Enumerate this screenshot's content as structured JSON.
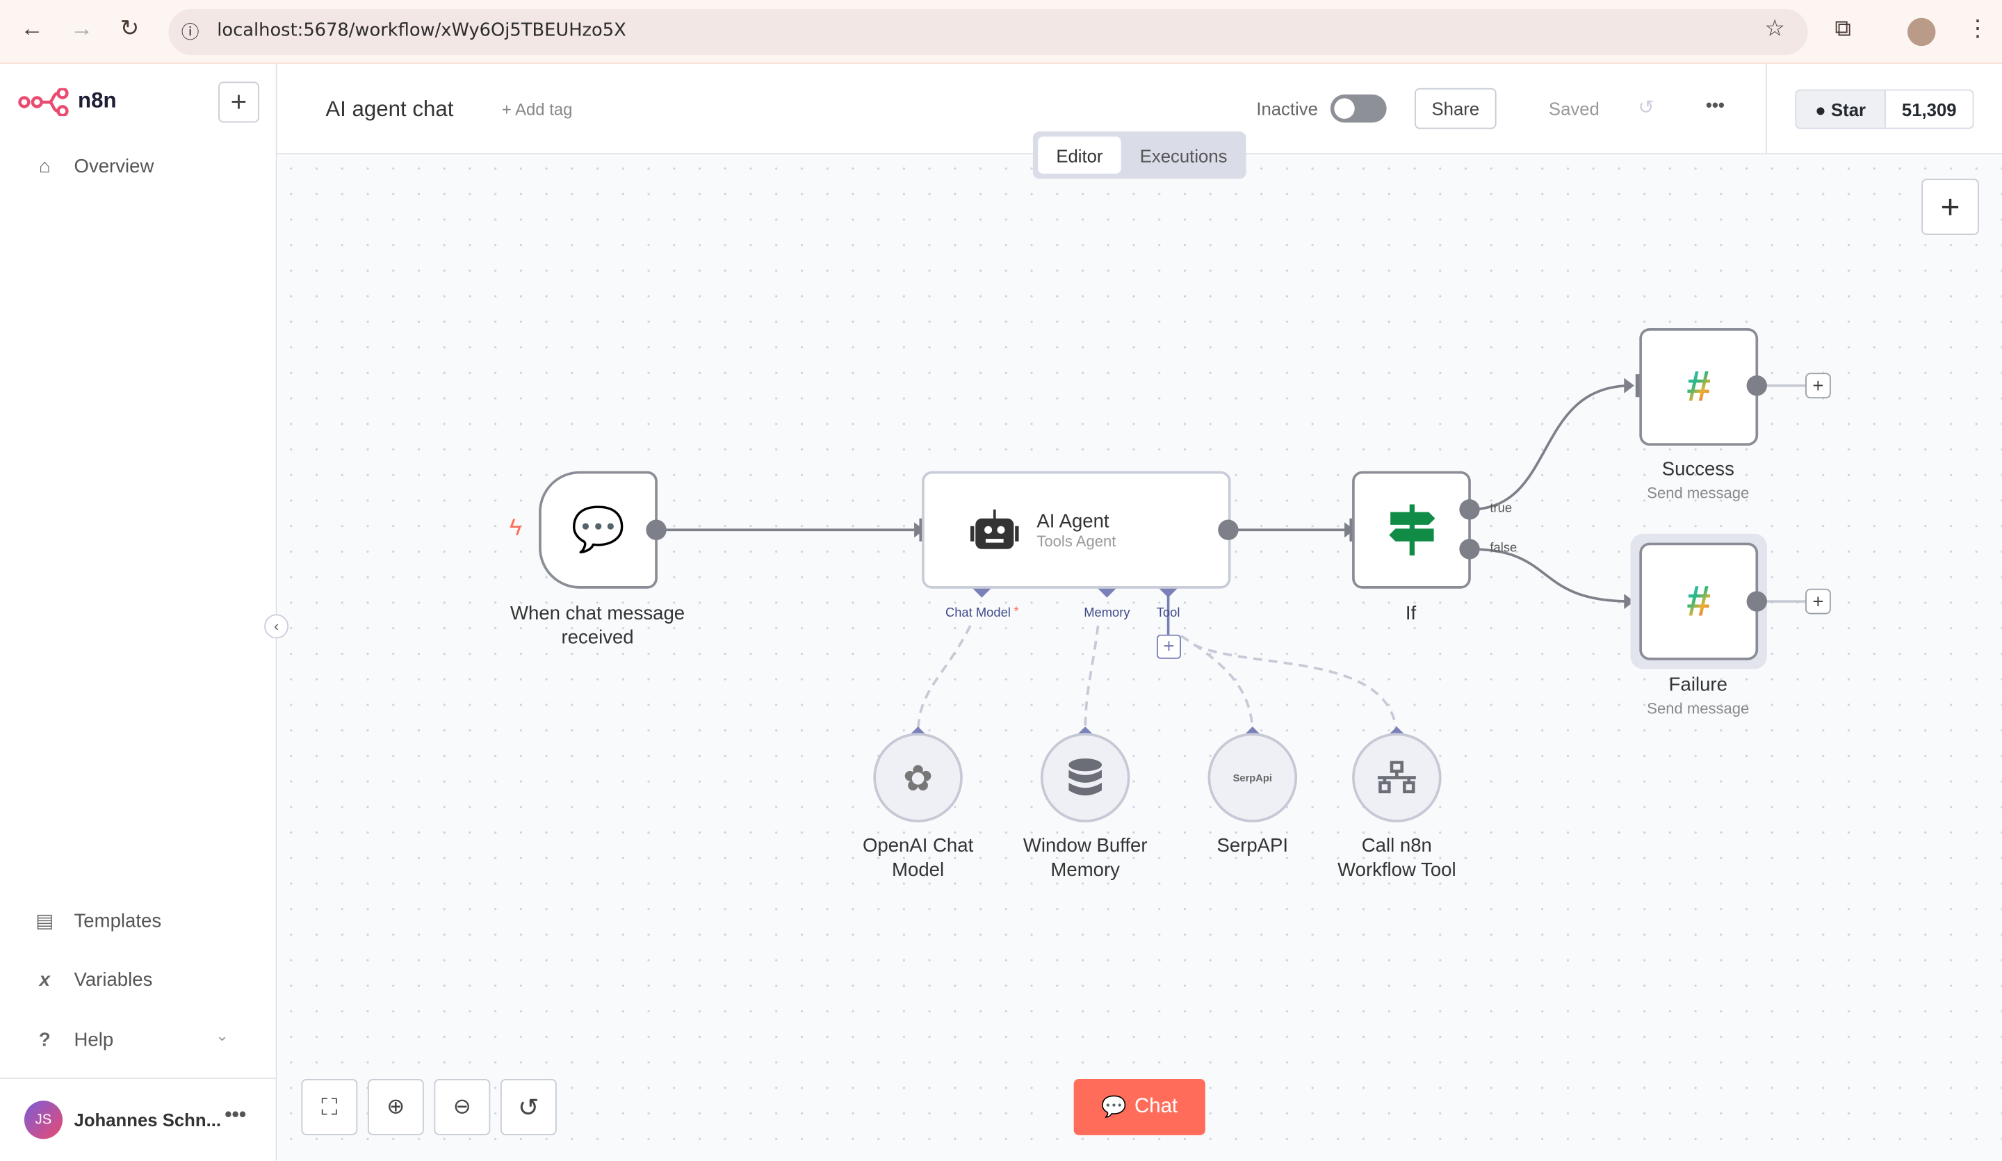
{
  "browser": {
    "url": "localhost:5678/workflow/xWy6Oj5TBEUHzo5X"
  },
  "sidebar": {
    "brand": "n8n",
    "items": [
      {
        "label": "Overview",
        "icon": "home-icon"
      }
    ],
    "bottom_items": [
      {
        "label": "Templates",
        "icon": "box-icon"
      },
      {
        "label": "Variables",
        "icon": "variable-icon"
      },
      {
        "label": "Help",
        "icon": "question-icon"
      }
    ],
    "user": {
      "initials": "JS",
      "name": "Johannes Schn..."
    }
  },
  "header": {
    "title": "AI agent chat",
    "add_tag": "+ Add tag",
    "status": "Inactive",
    "active": false,
    "share": "Share",
    "saved": "Saved",
    "github": {
      "star": "Star",
      "count": "51,309"
    }
  },
  "tabs": [
    {
      "label": "Editor",
      "active": true
    },
    {
      "label": "Executions",
      "active": false
    }
  ],
  "nodes": {
    "trigger": {
      "title": "When chat message received"
    },
    "agent": {
      "title": "AI Agent",
      "subtitle": "Tools Agent",
      "ports": [
        "Chat Model",
        "Memory",
        "Tool"
      ],
      "required_mark": "*"
    },
    "if": {
      "title": "If",
      "outputs": [
        "true",
        "false"
      ]
    },
    "success": {
      "title": "Success",
      "subtitle": "Send message"
    },
    "failure": {
      "title": "Failure",
      "subtitle": "Send message"
    },
    "openai": {
      "title": "OpenAI Chat Model"
    },
    "memory": {
      "title": "Window Buffer Memory"
    },
    "serp": {
      "title": "SerpAPI",
      "logo_text": "SerpApi"
    },
    "workflow": {
      "title": "Call n8n Workflow Tool"
    }
  },
  "chat_button": "Chat",
  "colors": {
    "accent": "#ff6d5a",
    "port": "#7a80b8",
    "if_green": "#108c47"
  }
}
